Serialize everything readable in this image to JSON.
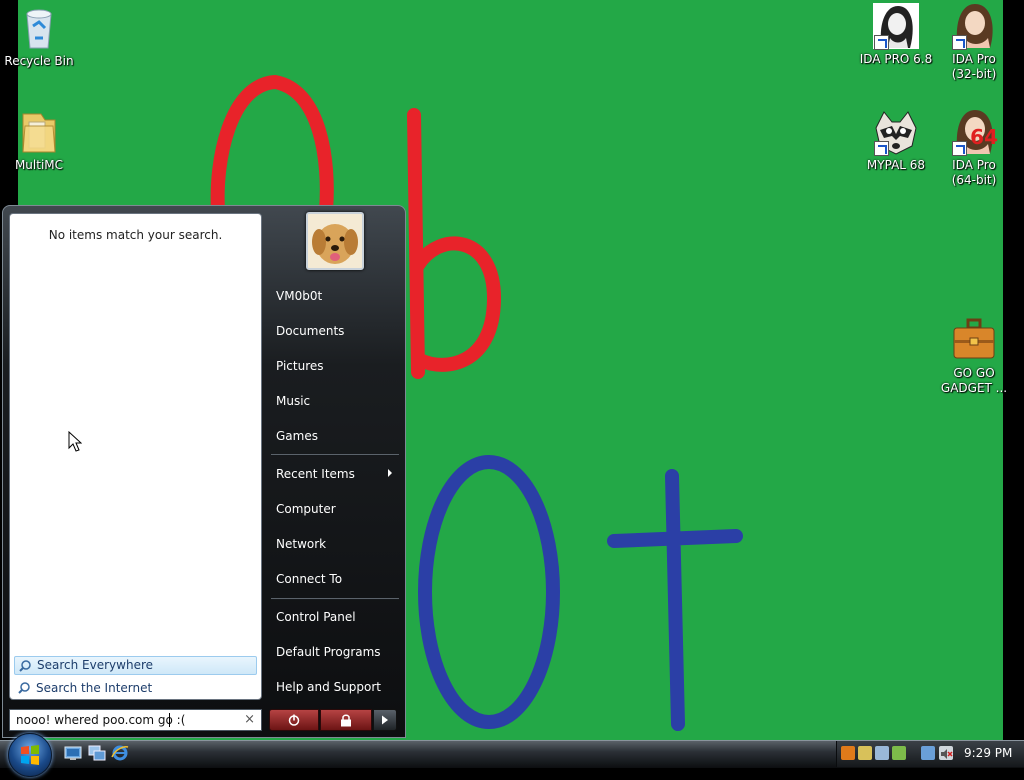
{
  "desktop": {
    "icons": [
      {
        "label": "Recycle Bin",
        "icon": "recycle-bin-icon"
      },
      {
        "label": "MultiMC",
        "icon": "folder-icon"
      },
      {
        "label": "IDA PRO 6.8",
        "icon": "ida-portrait-icon"
      },
      {
        "label": "IDA Pro (32-bit)",
        "line1": "IDA Pro",
        "line2": "(32-bit)",
        "icon": "ida-portrait-icon"
      },
      {
        "label": "MYPAL 68",
        "icon": "raccoon-icon"
      },
      {
        "label": "IDA Pro (64-bit)",
        "line1": "IDA Pro",
        "line2": "(64-bit)",
        "badge": "64",
        "icon": "ida-portrait-icon"
      },
      {
        "label": "GO GO GADGET ...",
        "line1": "GO GO",
        "line2": "GADGET ...",
        "icon": "briefcase-icon"
      }
    ],
    "colors": {
      "background": "#23a847",
      "red_paint": "#e8232a",
      "blue_paint": "#2b3fa6"
    }
  },
  "start_menu": {
    "no_results": "No items match your search.",
    "search_options": [
      "Search Everywhere",
      "Search the Internet"
    ],
    "search_query": "nooo! whered poo.com go :(",
    "clear_symbol": "×",
    "right_links": [
      {
        "label": "VM0b0t"
      },
      {
        "label": "Documents"
      },
      {
        "label": "Pictures"
      },
      {
        "label": "Music"
      },
      {
        "label": "Games"
      },
      {
        "label": "Recent Items"
      },
      {
        "label": "Computer"
      },
      {
        "label": "Network"
      },
      {
        "label": "Connect To"
      },
      {
        "label": "Control Panel"
      },
      {
        "label": "Default Programs"
      },
      {
        "label": "Help and Support"
      }
    ]
  },
  "taskbar": {
    "clock": "9:29 PM"
  }
}
